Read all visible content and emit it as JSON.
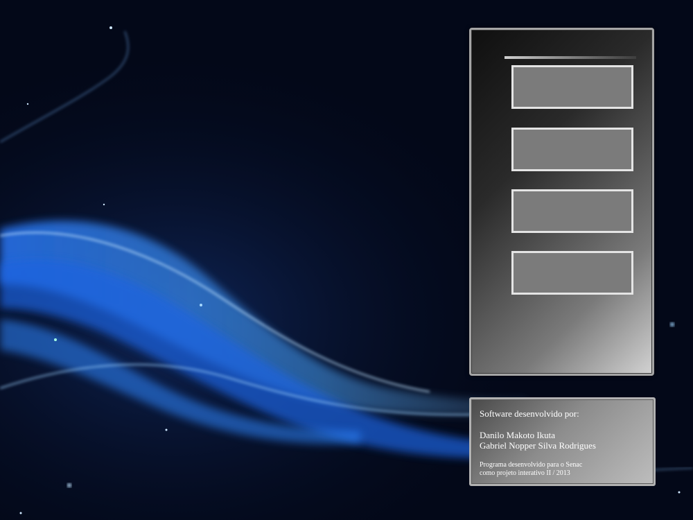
{
  "menu": {
    "buttons": [
      {
        "label": ""
      },
      {
        "label": ""
      },
      {
        "label": ""
      },
      {
        "label": ""
      }
    ]
  },
  "credits": {
    "title": "Software desenvolvido por:",
    "authors": [
      "Danilo Makoto Ikuta",
      "Gabriel Nopper Silva Rodrigues"
    ],
    "note_lines": [
      "Programa desenvolvido para o Senac",
      "como projeto interativo II / 2013"
    ]
  },
  "colors": {
    "background": "#030818",
    "wave_accent": "#3a8cff",
    "panel_border": "#a5a5a5",
    "button_fill": "#7b7b7b",
    "button_border": "#e4e4e4"
  }
}
